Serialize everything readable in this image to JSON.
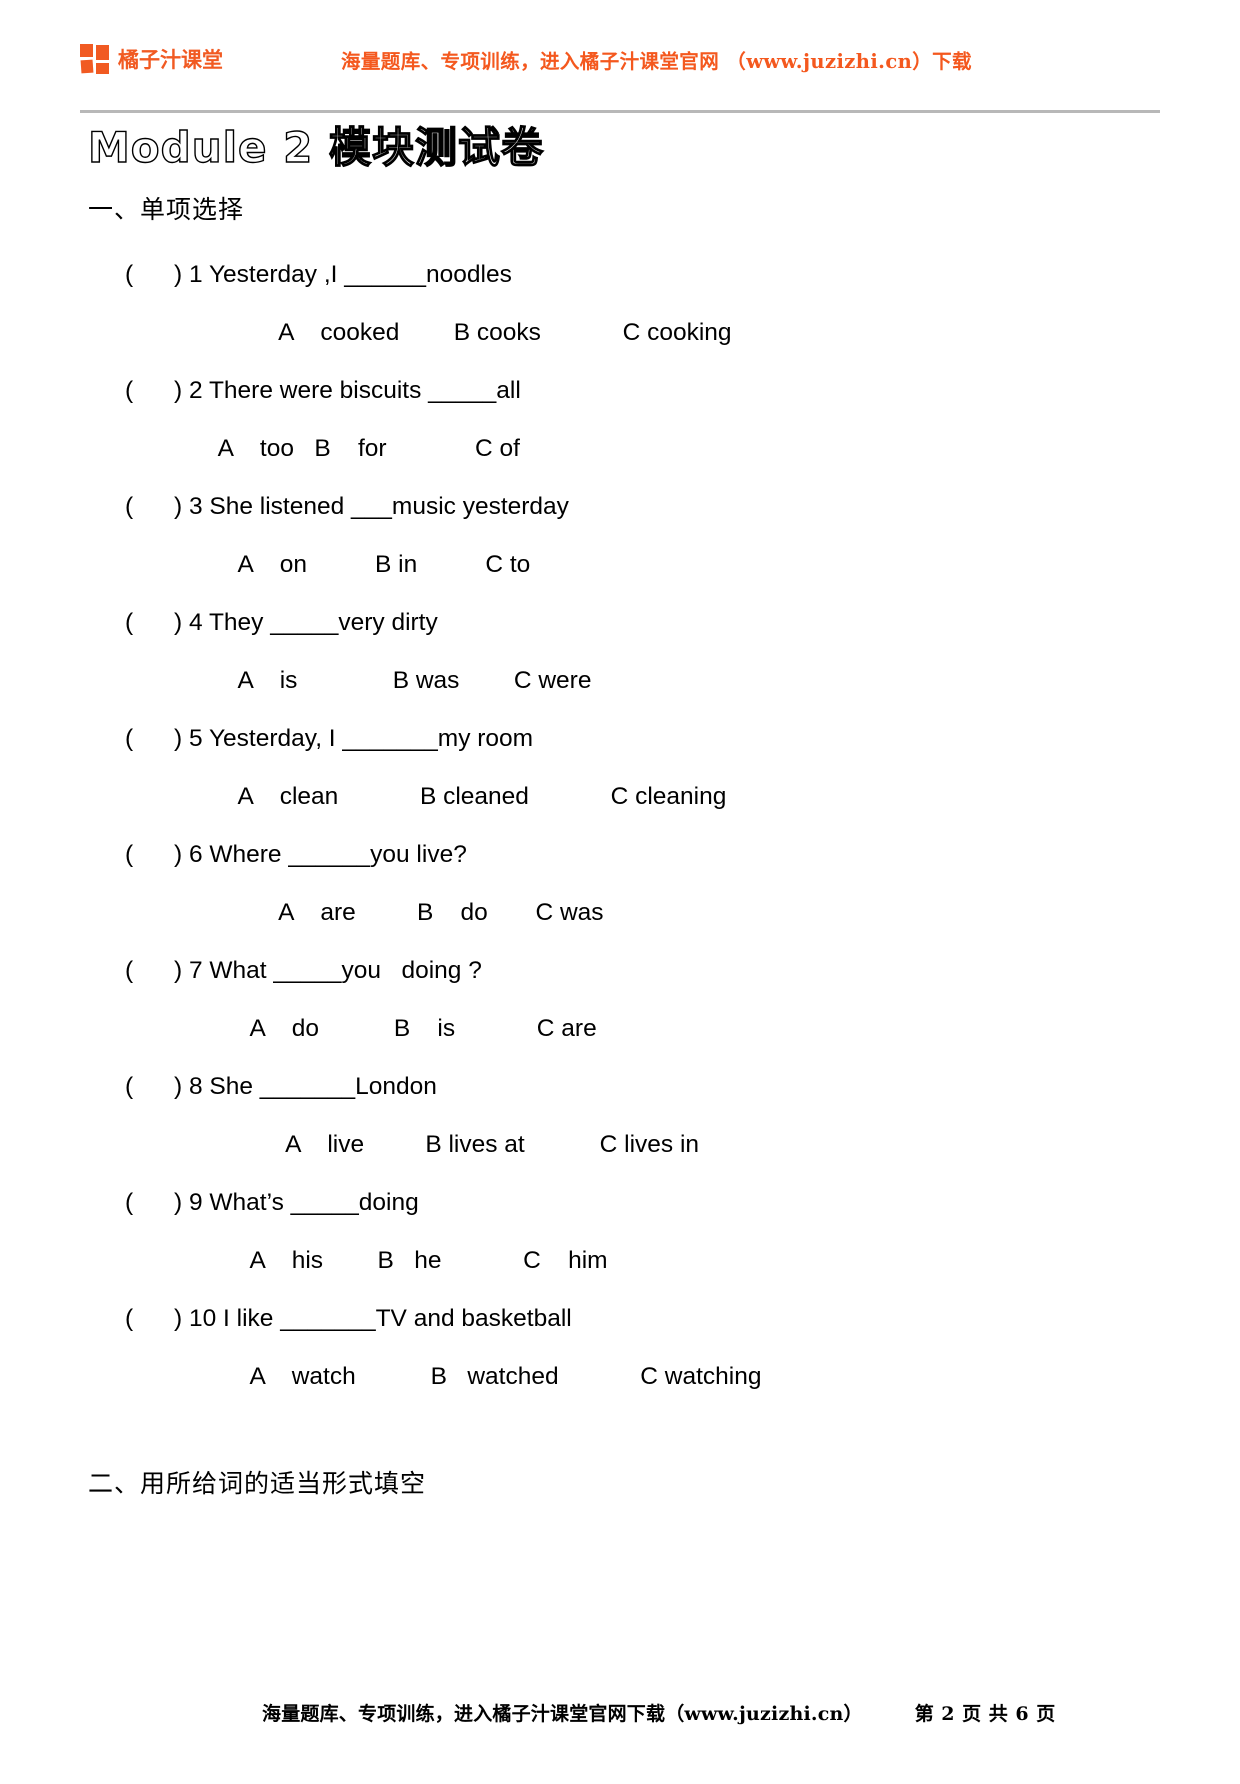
{
  "header": {
    "brand_name": "橘子汁课堂",
    "logo_icon": "orange-squares-logo",
    "promo": "海量题库、专项训练，进入橘子汁课堂官网 （www.juzizhi.cn）下载"
  },
  "title": "Module  2   模块测试卷",
  "sections": [
    {
      "heading": "一、单项选择"
    },
    {
      "heading": "二、用所给词的适当形式填空"
    }
  ],
  "questions": [
    {
      "prompt": "(      ) 1 Yesterday ,I ______noodles",
      "options": "        A    cooked        B cooks            C cooking",
      "options_indent": 225
    },
    {
      "prompt": "(      ) 2 There were biscuits _____all",
      "options": "     A    too   B    for             C of",
      "options_indent": 185
    },
    {
      "prompt": "(      ) 3 She listened ___music yesterday",
      "options": "      A    on          B in          C to",
      "options_indent": 198
    },
    {
      "prompt": "(      ) 4 They _____very dirty",
      "options": "      A    is              B was        C were",
      "options_indent": 198
    },
    {
      "prompt": "(      ) 5 Yesterday, I _______my room",
      "options": "      A    clean            B cleaned            C cleaning",
      "options_indent": 198
    },
    {
      "prompt": "(      ) 6 Where ______you live?",
      "options": "        A    are         B    do       C was",
      "options_indent": 225
    },
    {
      "prompt": "(      ) 7 What _____you   doing ?",
      "options": "      A    do           B    is            C are",
      "options_indent": 210
    },
    {
      "prompt": "(      ) 8 She _______London",
      "options": "        A    live         B lives at           C lives in",
      "options_indent": 232
    },
    {
      "prompt": "(      ) 9 What’s _____doing",
      "options": "      A    his        B   he            C    him",
      "options_indent": 210
    },
    {
      "prompt": "(      ) 10 I like _______TV and basketball",
      "options": "      A    watch           B   watched            C watching",
      "options_indent": 210
    }
  ],
  "footer": {
    "promo": "海量题库、专项训练，进入橘子汁课堂官网下载（www.juzizhi.cn）",
    "page_info": "第 2 页 共 6 页"
  },
  "colors": {
    "brand_orange": "#F15A22",
    "header_promo_orange": "#F4581E",
    "rule_gray": "#b8b8b8"
  }
}
